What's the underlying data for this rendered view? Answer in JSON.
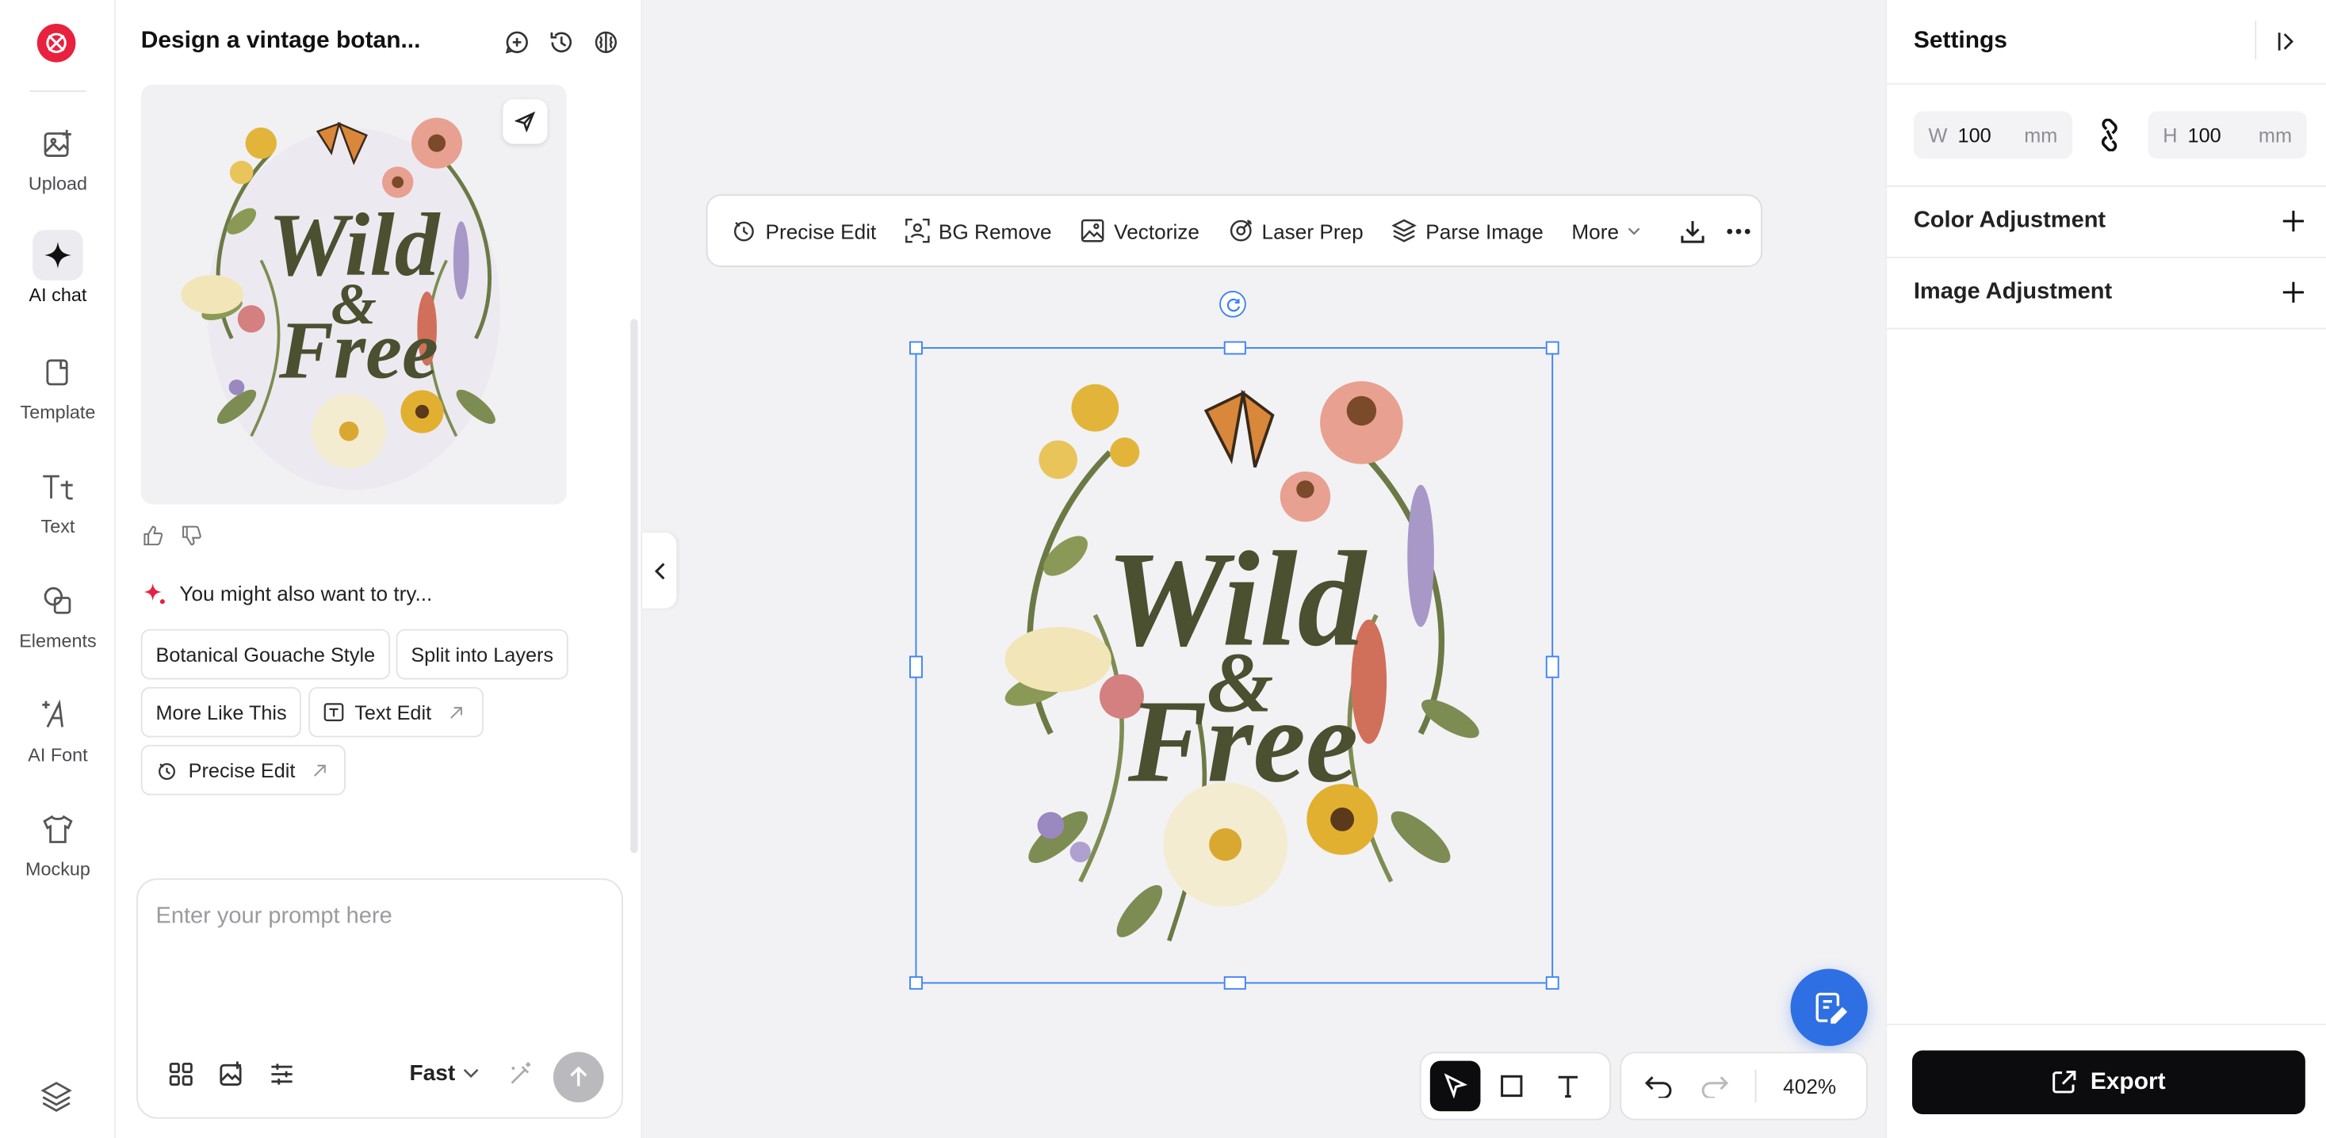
{
  "rail": {
    "items": [
      {
        "label": "Upload"
      },
      {
        "label": "AI chat"
      },
      {
        "label": "Template"
      },
      {
        "label": "Text"
      },
      {
        "label": "Elements"
      },
      {
        "label": "AI Font"
      },
      {
        "label": "Mockup"
      }
    ],
    "active_index": 1
  },
  "chat": {
    "title": "Design a vintage botan...",
    "preview_art": {
      "line1": "Wild",
      "line2": "&",
      "line3": "Free"
    },
    "suggest_heading": "You might also want to try...",
    "suggestions": [
      {
        "label": "Botanical Gouache Style"
      },
      {
        "label": "Split into Layers"
      },
      {
        "label": "More Like This"
      },
      {
        "label": "Text Edit"
      },
      {
        "label": "Precise Edit"
      }
    ],
    "prompt": {
      "placeholder": "Enter your prompt here",
      "mode": "Fast"
    }
  },
  "toolbar": {
    "items": [
      {
        "label": "Precise Edit"
      },
      {
        "label": "BG Remove"
      },
      {
        "label": "Vectorize"
      },
      {
        "label": "Laser Prep"
      },
      {
        "label": "Parse Image"
      },
      {
        "label": "More"
      }
    ]
  },
  "canvas": {
    "art": {
      "line1": "Wild",
      "line2": "&",
      "line3": "Free"
    },
    "zoom": "402%"
  },
  "settings": {
    "title": "Settings",
    "width": {
      "key": "W",
      "value": "100",
      "unit": "mm"
    },
    "height": {
      "key": "H",
      "value": "100",
      "unit": "mm"
    },
    "sections": [
      {
        "label": "Color Adjustment"
      },
      {
        "label": "Image Adjustment"
      }
    ],
    "export_label": "Export"
  },
  "colors": {
    "brand": "#e8213f",
    "selection": "#3b82f6",
    "fab": "#2f6fe4",
    "primary_button": "#0c0c0e"
  }
}
